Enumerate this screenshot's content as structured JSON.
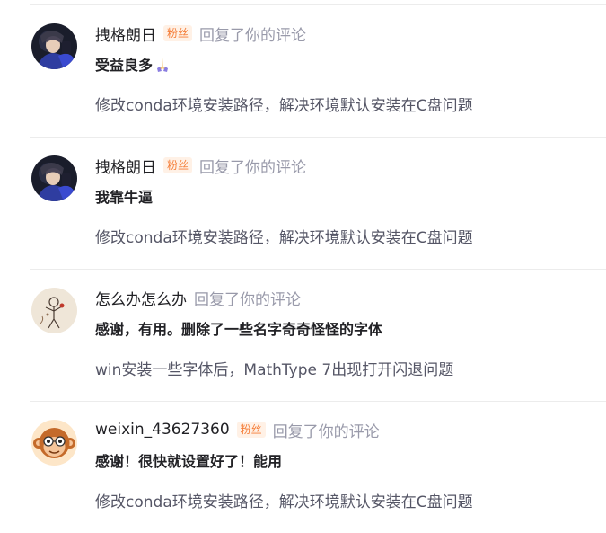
{
  "comments": [
    {
      "username": "拽格朗日",
      "badge": "粉丝",
      "action": "回复了你的评论",
      "comment": "受益良多",
      "comment_emoji": "pray-emoji",
      "article": "修改conda环境安装路径，解决环境默认安装在C盘问题",
      "avatar_icon": "anime-character-avatar"
    },
    {
      "username": "拽格朗日",
      "badge": "粉丝",
      "action": "回复了你的评论",
      "comment": "我靠牛逼",
      "article": "修改conda环境安装路径，解决环境默认安装在C盘问题",
      "avatar_icon": "anime-character-avatar"
    },
    {
      "username": "怎么办怎么办",
      "action": "回复了你的评论",
      "comment": "感谢，有用。删除了一些名字奇奇怪怪的字体",
      "article": "win安装一些字体后，MathType 7出现打开闪退问题",
      "avatar_icon": "sketch-figure-avatar"
    },
    {
      "username": "weixin_43627360",
      "badge": "粉丝",
      "action": "回复了你的评论",
      "comment": "感谢！很快就设置好了！能用",
      "article": "修改conda环境安装路径，解决环境默认安装在C盘问题",
      "avatar_icon": "monkey-avatar"
    }
  ],
  "colors": {
    "badge_text": "#f57c36",
    "badge_bg": "#fff1e6",
    "muted_text": "#999aaa",
    "article_text": "#555666",
    "divider": "#ececec"
  }
}
